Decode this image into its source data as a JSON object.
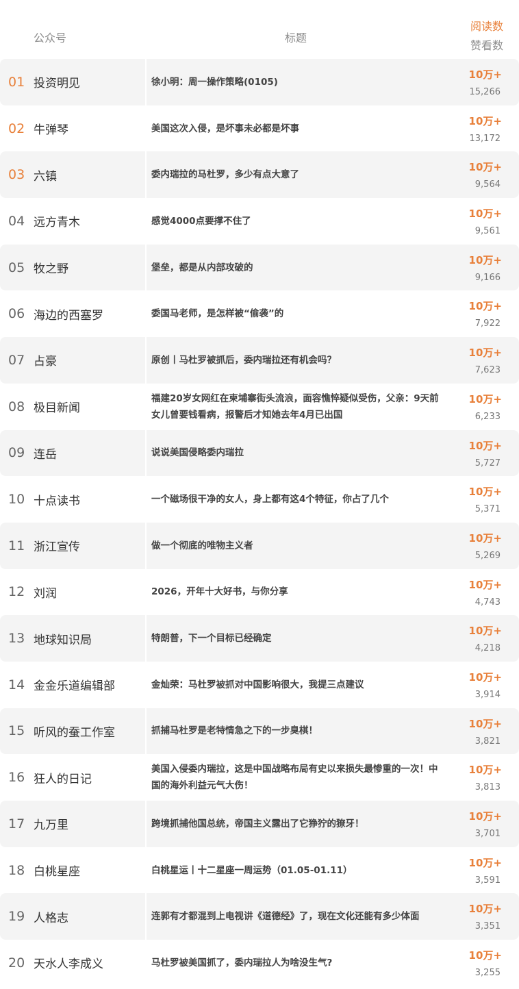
{
  "header": {
    "account": "公众号",
    "title": "标题",
    "reads": "阅读数",
    "likes": "赞看数"
  },
  "accent_color": "#e8803a",
  "rows": [
    {
      "rank": "01",
      "account": "投资明见",
      "title": "徐小明：周一操作策略(0105)",
      "reads": "10万+",
      "likes": "15,266"
    },
    {
      "rank": "02",
      "account": "牛弹琴",
      "title": "美国这次入侵，是坏事未必都是坏事",
      "reads": "10万+",
      "likes": "13,172"
    },
    {
      "rank": "03",
      "account": "六镇",
      "title": "委内瑞拉的马杜罗，多少有点大意了",
      "reads": "10万+",
      "likes": "9,564"
    },
    {
      "rank": "04",
      "account": "远方青木",
      "title": "感觉4000点要撑不住了",
      "reads": "10万+",
      "likes": "9,561"
    },
    {
      "rank": "05",
      "account": "牧之野",
      "title": "堡垒，都是从内部攻破的",
      "reads": "10万+",
      "likes": "9,166"
    },
    {
      "rank": "06",
      "account": "海边的西塞罗",
      "title": "委国马老师，是怎样被“偷袭”的",
      "reads": "10万+",
      "likes": "7,922"
    },
    {
      "rank": "07",
      "account": "占豪",
      "title": "原创丨马杜罗被抓后，委内瑞拉还有机会吗？",
      "reads": "10万+",
      "likes": "7,623"
    },
    {
      "rank": "08",
      "account": "极目新闻",
      "title": "福建20岁女网红在柬埔寨街头流浪，面容憔悴疑似受伤，父亲：9天前女儿曾要钱看病，报警后才知她去年4月已出国",
      "reads": "10万+",
      "likes": "6,233"
    },
    {
      "rank": "09",
      "account": "连岳",
      "title": "说说美国侵略委内瑞拉",
      "reads": "10万+",
      "likes": "5,727"
    },
    {
      "rank": "10",
      "account": "十点读书",
      "title": "一个磁场很干净的女人，身上都有这4个特征，你占了几个",
      "reads": "10万+",
      "likes": "5,371"
    },
    {
      "rank": "11",
      "account": "浙江宣传",
      "title": "做一个彻底的唯物主义者",
      "reads": "10万+",
      "likes": "5,269"
    },
    {
      "rank": "12",
      "account": "刘润",
      "title": "2026，开年十大好书，与你分享",
      "reads": "10万+",
      "likes": "4,743"
    },
    {
      "rank": "13",
      "account": "地球知识局",
      "title": "特朗普，下一个目标已经确定",
      "reads": "10万+",
      "likes": "4,218"
    },
    {
      "rank": "14",
      "account": "金金乐道编辑部",
      "title": "金灿荣：马杜罗被抓对中国影响很大，我提三点建议",
      "reads": "10万+",
      "likes": "3,914"
    },
    {
      "rank": "15",
      "account": "听风的蚕工作室",
      "title": "抓捕马杜罗是老特情急之下的一步臭棋！",
      "reads": "10万+",
      "likes": "3,821"
    },
    {
      "rank": "16",
      "account": "狂人的日记",
      "title": "美国入侵委内瑞拉，这是中国战略布局有史以来损失最惨重的一次！中国的海外利益元气大伤！",
      "reads": "10万+",
      "likes": "3,813"
    },
    {
      "rank": "17",
      "account": "九万里",
      "title": "跨境抓捕他国总统，帝国主义露出了它狰狞的獠牙！",
      "reads": "10万+",
      "likes": "3,701"
    },
    {
      "rank": "18",
      "account": "白桃星座",
      "title": "白桃星运丨十二星座一周运势（01.05-01.11）",
      "reads": "10万+",
      "likes": "3,591"
    },
    {
      "rank": "19",
      "account": "人格志",
      "title": "连郭有才都混到上电视讲《道德经》了，现在文化还能有多少体面",
      "reads": "10万+",
      "likes": "3,351"
    },
    {
      "rank": "20",
      "account": "天水人李成义",
      "title": "马杜罗被美国抓了，委内瑞拉人为啥没生气?",
      "reads": "10万+",
      "likes": "3,255"
    }
  ]
}
